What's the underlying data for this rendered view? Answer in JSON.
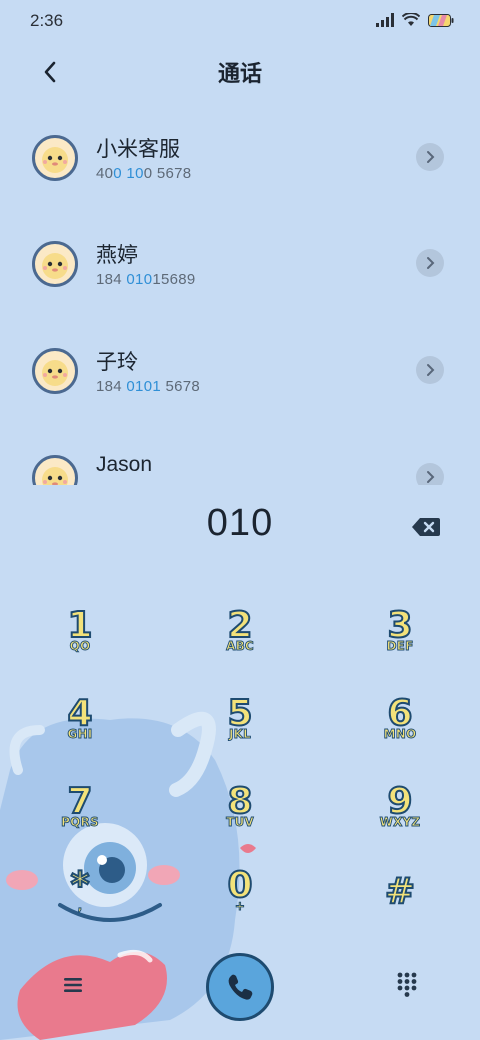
{
  "status_bar": {
    "time": "2:36",
    "icons": [
      "signal-icon",
      "wifi-icon",
      "battery-icon"
    ]
  },
  "header": {
    "title": "通话",
    "back_icon": "chevron-left-icon"
  },
  "contacts": [
    {
      "name": "小米客服",
      "number_parts": [
        {
          "text": "40",
          "hl": false
        },
        {
          "text": "0",
          "hl": true
        },
        {
          "text": " ",
          "hl": false
        },
        {
          "text": "10",
          "hl": true
        },
        {
          "text": "0 5678",
          "hl": false
        }
      ]
    },
    {
      "name": "燕婷",
      "number_parts": [
        {
          "text": "184 ",
          "hl": false
        },
        {
          "text": "010",
          "hl": true
        },
        {
          "text": "15689",
          "hl": false
        }
      ]
    },
    {
      "name": "子玲",
      "number_parts": [
        {
          "text": "184 ",
          "hl": false
        },
        {
          "text": "0101",
          "hl": true
        },
        {
          "text": " 5678",
          "hl": false
        }
      ]
    },
    {
      "name": "Jason",
      "number_parts": []
    }
  ],
  "dialer": {
    "number": "010",
    "backspace_icon": "backspace-icon"
  },
  "keypad": [
    {
      "digit": "1",
      "letters": "QO"
    },
    {
      "digit": "2",
      "letters": "ABC"
    },
    {
      "digit": "3",
      "letters": "DEF"
    },
    {
      "digit": "4",
      "letters": "GHI"
    },
    {
      "digit": "5",
      "letters": "JKL"
    },
    {
      "digit": "6",
      "letters": "MNO"
    },
    {
      "digit": "7",
      "letters": "PQRS"
    },
    {
      "digit": "8",
      "letters": "TUV"
    },
    {
      "digit": "9",
      "letters": "WXYZ"
    },
    {
      "digit": "*",
      "letters": ","
    },
    {
      "digit": "0",
      "letters": "+"
    },
    {
      "digit": "#",
      "letters": ""
    }
  ],
  "bottom_bar": {
    "menu_icon": "menu-icon",
    "call_icon": "phone-icon",
    "keypad_icon": "keypad-grid-icon"
  },
  "colors": {
    "background": "#c6dbf3",
    "accent": "#2f8fd6",
    "call_button": "#5aa5dc",
    "key_fill": "#f3e27a",
    "key_stroke": "#1e4b70"
  }
}
